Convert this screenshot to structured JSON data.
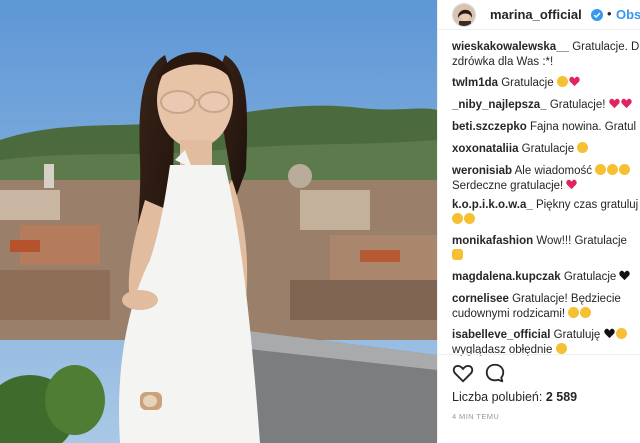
{
  "post": {
    "username": "marina_official",
    "follow_label": "Observuj",
    "separator": "•",
    "likes_label": "Liczba polubień:",
    "likes_count": "2 589",
    "time_label": "4 MIN TEMU"
  },
  "comments": [
    {
      "user": "wieskakowalewska__",
      "text": "Gratulacje. Du",
      "text2": "zdrówka dla Was :*!",
      "emoji": []
    },
    {
      "user": "twlm1da",
      "text": "Gratulacje",
      "emoji": [
        "smile-hearts-emoji",
        "red-heart-icon"
      ]
    },
    {
      "user": "_niby_najlepsza_",
      "text": "Gratulacje!",
      "emoji": [
        "red-heart-icon",
        "red-heart-icon"
      ]
    },
    {
      "user": "beti.szczepko",
      "text": "Fajna nowina. Gratul",
      "emoji": []
    },
    {
      "user": "xoxonataliia",
      "text": "Gratulacje",
      "emoji": [
        "smile-hearts-emoji"
      ]
    },
    {
      "user": "weronisiab",
      "text": "Ale wiadomość",
      "text2": "Serdeczne gratulacje!",
      "emoji": [
        "smile-hearts-emoji",
        "smile-hearts-emoji",
        "smile-hearts-emoji"
      ]
    },
    {
      "user": "k.o.p.i.k.o.w.a_",
      "text": "Piękny czas gratuluj",
      "emoji": [
        "smile-hearts-emoji",
        "smile-hearts-emoji"
      ]
    },
    {
      "user": "monikafashion",
      "text": "Wow!!! Gratulacje",
      "emoji": [
        "clapping-hand-emoji"
      ]
    },
    {
      "user": "magdalena.kupczak",
      "text": "Gratulacje",
      "emoji": [
        "black-heart-icon"
      ]
    },
    {
      "user": "cornelisee",
      "text": "Gratulacje! Będziecie",
      "text2": "cudownymi rodzicami!",
      "emoji": [
        "grinning-emoji",
        "grinning-emoji"
      ]
    },
    {
      "user": "isabelleve_official",
      "text": "Gratuluję",
      "text2": "wyglądasz obłędnie",
      "emoji": [
        "black-heart-icon",
        "smile-hearts-emoji",
        "smile-hearts-emoji"
      ]
    }
  ],
  "icons": {
    "like": "heart-outline-icon",
    "comment": "comment-bubble-icon",
    "verified": "verified-badge-icon"
  },
  "colors": {
    "link": "#3897f0",
    "verified": "#3897f0",
    "heart": "#e0245e",
    "emoji": "#f6c033",
    "muted": "#999999"
  }
}
